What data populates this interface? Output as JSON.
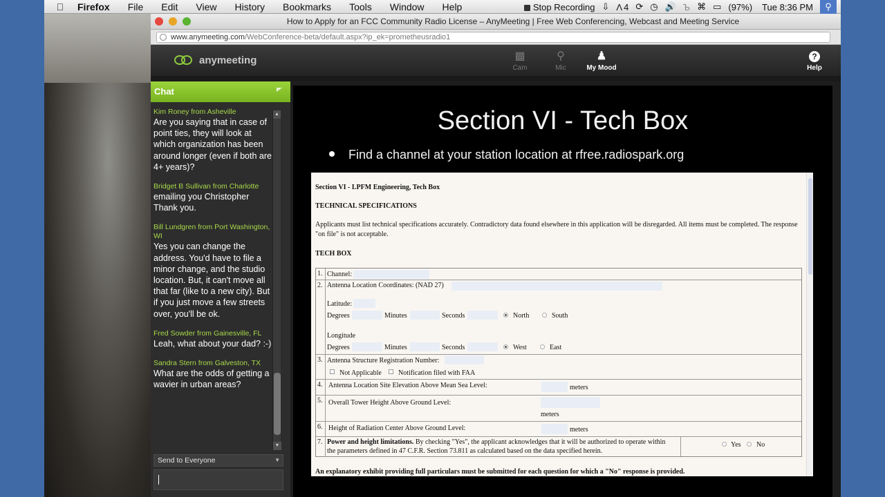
{
  "menubar": {
    "app": "Firefox",
    "items": [
      "File",
      "Edit",
      "View",
      "History",
      "Bookmarks",
      "Tools",
      "Window",
      "Help"
    ],
    "recording": "Stop Recording",
    "battery": "(97%)",
    "clock": "Tue 8:36 PM",
    "tray_count": "4"
  },
  "browser": {
    "title": "How to Apply for an FCC Community Radio License – AnyMeeting | Free Web Conferencing, Webcast and Meeting Service",
    "url_domain": "www.anymeeting.com",
    "url_path": "/WebConference-beta/default.aspx?ip_ek=prometheusradio1"
  },
  "app": {
    "logo": "anymeeting",
    "tools": {
      "cam": "Cam",
      "mic": "Mic",
      "mood": "My Mood",
      "help": "Help"
    },
    "help_glyph": "?"
  },
  "chat": {
    "title": "Chat",
    "messages": [
      {
        "who": "Kim Roney from Asheville",
        "text": "Are you saying that in case of point ties, they will look at which organization has been around longer (even if both are 4+ years)?"
      },
      {
        "who": "Bridget B Sullivan from Charlotte",
        "text": "emailing you Christopher Thank you."
      },
      {
        "who": "Bill Lundgren from Port Washington, WI",
        "text": "Yes you can change the address. You'd have to file a minor change, and the studio location. But, it can't move all that far (like to a new city). But if you just move a few streets over, you'll be ok."
      },
      {
        "who": "Fred Sowder from Gainesville, FL",
        "text": "Leah, what about your dad? :-)"
      },
      {
        "who": "Sandra Stern from Galveston, TX",
        "text": "What are the odds of getting a wavier in urban areas?"
      }
    ],
    "send_to": "Send to Everyone"
  },
  "slide": {
    "title": "Section VI - Tech Box",
    "bullet": "Find a channel at your station location at rfree.radiospark.org",
    "doc": {
      "heading": "Section VI - LPFM Engineering, Tech Box",
      "subheading": "TECHNICAL SPECIFICATIONS",
      "paragraph": "Applicants must list technical specifications accurately. Contradictory data found elsewhere in this application will be disregarded. All items must be completed. The response \"on file\" is not acceptable.",
      "box_label": "TECH BOX",
      "rows": {
        "r1_num": "1.",
        "channel": "Channel:",
        "r2_num": "2.",
        "coords": "Antenna Location Coordinates: (NAD 27)",
        "latitude": "Latitude:",
        "longitude": "Longitude",
        "degrees": "Degrees",
        "minutes": "Minutes",
        "seconds": "Seconds",
        "north": "North",
        "south": "South",
        "west": "West",
        "east": "East",
        "r3_num": "3.",
        "asr": "Antenna Structure Registration Number:",
        "not_applicable": "Not Applicable",
        "notification": "Notification filed with FAA",
        "r4_num": "4.",
        "elevation": "Antenna Location Site Elevation Above Mean Sea Level:",
        "r5_num": "5.",
        "tower": "Overall Tower Height Above Ground Level:",
        "r6_num": "6.",
        "radiation": "Height of Radiation Center Above Ground Level:",
        "meters": "meters",
        "r7_num": "7.",
        "power_bold": "Power and height limitations.",
        "power_text": " By checking \"Yes\", the applicant acknowledges that it will be authorized to operate within",
        "power_text2": "the parameters defined in 47 C.F.R. Section 73.811 as calculated based on the data specified herein.",
        "yes": "Yes",
        "no": "No"
      },
      "footer": "An explanatory exhibit providing full particulars must be submitted for each question for which a \"No\" response is provided."
    }
  }
}
